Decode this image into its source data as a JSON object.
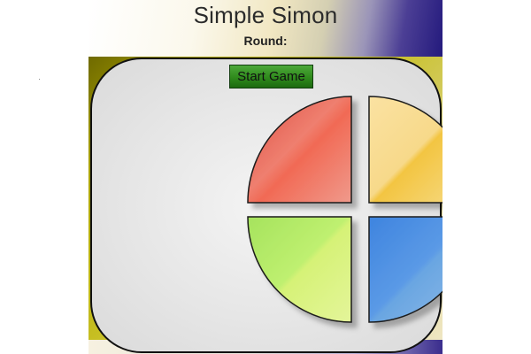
{
  "game": {
    "title": "Simple Simon",
    "round_label": "Round:",
    "round_value": "",
    "start_button_label": "Start Game"
  },
  "colors": {
    "red": "#ee6a5a",
    "yellow": "#f4ce62",
    "green": "#c4ec6a",
    "blue": "#5f9ee0",
    "outline": "#1a1a1a"
  },
  "pads": [
    {
      "name": "red-pad",
      "color": "red"
    },
    {
      "name": "yellow-pad",
      "color": "yellow"
    },
    {
      "name": "green-pad",
      "color": "green"
    },
    {
      "name": "blue-pad",
      "color": "blue"
    }
  ]
}
